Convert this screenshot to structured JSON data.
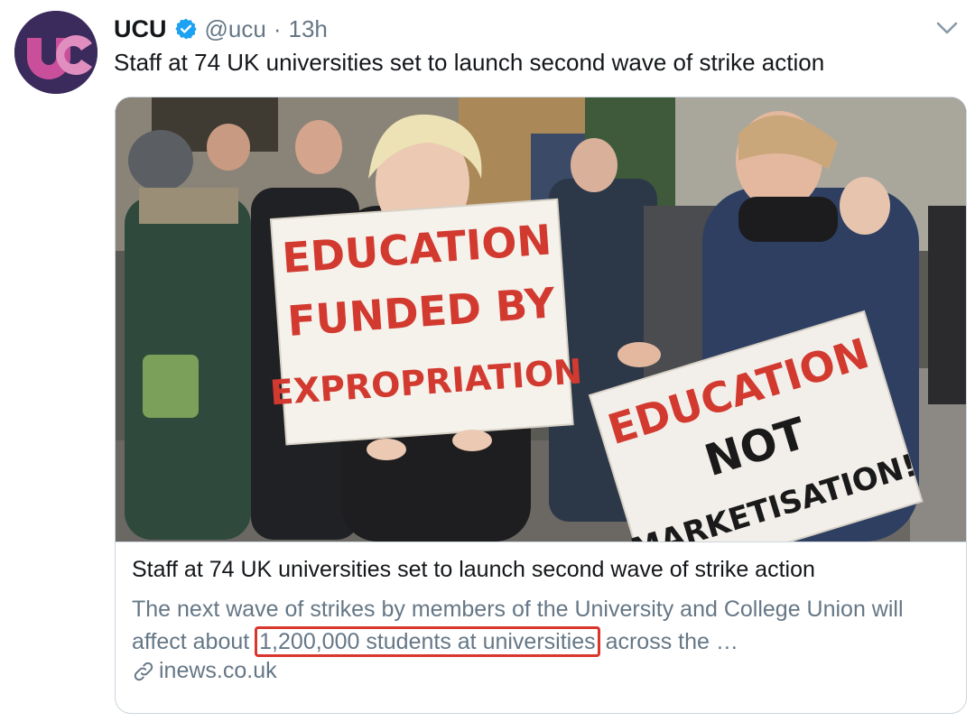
{
  "author": {
    "display_name": "UCU",
    "handle": "@ucu",
    "separator": "·",
    "time": "13h",
    "avatar_text": "uc"
  },
  "tweet": {
    "text": "Staff at 74 UK universities set to launch second wave of strike action"
  },
  "card": {
    "title": "Staff at 74 UK universities set to launch second wave of strike action",
    "description_before": "The next wave of strikes by members of the University and College Union will affect about ",
    "description_highlight": "1,200,000 students at universities",
    "description_after": " across the …",
    "domain": "inews.co.uk",
    "image": {
      "sign_left": [
        "EDUCATION",
        "FUNDED BY",
        "EXPROPRIATION"
      ],
      "sign_right": [
        "EDUCATION",
        "NOT",
        "MARKETISATION!"
      ]
    }
  },
  "colors": {
    "verified": "#1da1f2",
    "highlight_box": "#d9362d",
    "avatar_bg": "#3b2a5c",
    "avatar_accent": "#c94f9b"
  },
  "icons": [
    "verified-badge-icon",
    "chevron-down-icon",
    "link-icon"
  ]
}
